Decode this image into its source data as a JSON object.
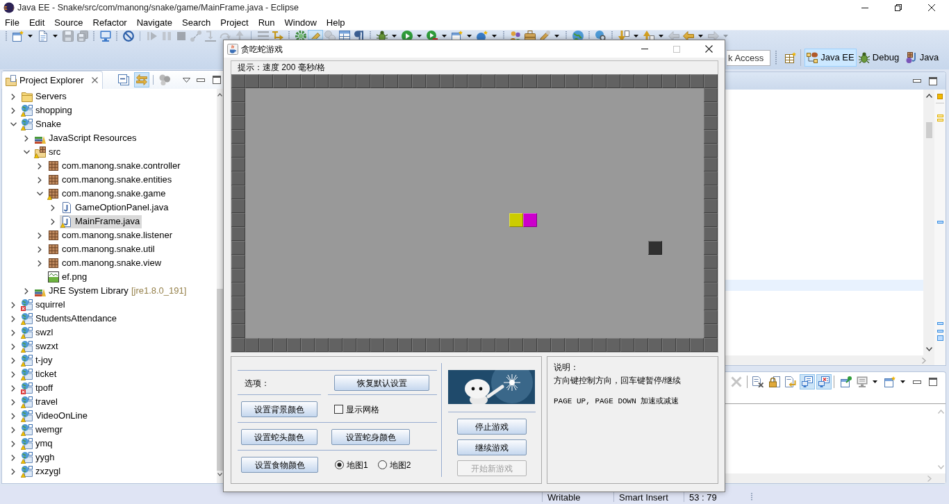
{
  "window": {
    "title": "Java EE - Snake/src/com/manong/snake/game/MainFrame.java - Eclipse"
  },
  "menu": [
    "File",
    "Edit",
    "Source",
    "Refactor",
    "Navigate",
    "Search",
    "Project",
    "Run",
    "Window",
    "Help"
  ],
  "toolbar": [
    {
      "disabled": false,
      "pressed": false
    },
    {
      "disabled": false,
      "pressed": false
    },
    {
      "disabled": true,
      "pressed": false
    },
    {
      "disabled": true,
      "pressed": false
    },
    {
      "disabled": false,
      "pressed": false
    },
    {
      "disabled": false,
      "pressed": false
    },
    {
      "disabled": true,
      "pressed": false
    },
    {
      "disabled": true,
      "pressed": false
    },
    {
      "disabled": true,
      "pressed": false
    },
    {
      "disabled": true,
      "pressed": false
    },
    {
      "disabled": true,
      "pressed": false
    },
    {
      "disabled": true,
      "pressed": false
    },
    {
      "disabled": true,
      "pressed": false
    },
    {
      "disabled": true,
      "pressed": false
    },
    {
      "disabled": false,
      "pressed": false
    },
    {
      "disabled": false,
      "pressed": false
    },
    {
      "disabled": false,
      "pressed": true
    },
    {
      "disabled": true,
      "pressed": false
    },
    {
      "disabled": false,
      "pressed": false
    },
    {
      "disabled": false,
      "pressed": false
    },
    {
      "disabled": false,
      "pressed": false
    },
    {
      "disabled": false,
      "pressed": false
    },
    {
      "disabled": false,
      "pressed": false
    },
    {
      "disabled": false,
      "pressed": false
    },
    {
      "disabled": false,
      "pressed": false
    },
    {
      "disabled": false,
      "pressed": false
    },
    {
      "disabled": false,
      "pressed": false
    },
    {
      "disabled": false,
      "pressed": false
    },
    {
      "disabled": false,
      "pressed": false
    },
    {
      "disabled": false,
      "pressed": false
    },
    {
      "disabled": false,
      "pressed": false
    },
    {
      "disabled": false,
      "pressed": false
    },
    {
      "disabled": true,
      "pressed": false
    },
    {
      "disabled": false,
      "pressed": false
    },
    {
      "disabled": true,
      "pressed": false
    }
  ],
  "quick_access": {
    "placeholder": "k Access"
  },
  "perspectives": [
    {
      "label": "Java EE",
      "selected": true
    },
    {
      "label": "Debug",
      "selected": false
    },
    {
      "label": "Java",
      "selected": false
    }
  ],
  "project_explorer": {
    "title": "Project Explorer",
    "tools": [
      {
        "pressed": false
      },
      {
        "pressed": true
      },
      {
        "pressed": false
      }
    ],
    "items": [
      {
        "label": "Servers",
        "kind": "folder",
        "expanded": false,
        "selected": false
      },
      {
        "label": "shopping",
        "kind": "project",
        "warning": true,
        "expanded": false,
        "selected": false
      },
      {
        "label": "Snake",
        "kind": "project",
        "warning": true,
        "expanded": true,
        "selected": false,
        "children": [
          {
            "label": "JavaScript Resources",
            "kind": "library",
            "expanded": false,
            "selected": false
          },
          {
            "label": "src",
            "kind": "source-folder",
            "warning": true,
            "expanded": true,
            "selected": false,
            "children": [
              {
                "label": "com.manong.snake.controller",
                "kind": "package",
                "expanded": false,
                "selected": false
              },
              {
                "label": "com.manong.snake.entities",
                "kind": "package",
                "expanded": false,
                "selected": false
              },
              {
                "label": "com.manong.snake.game",
                "kind": "package",
                "warning": true,
                "expanded": true,
                "selected": false,
                "children": [
                  {
                    "label": "GameOptionPanel.java",
                    "kind": "java-file",
                    "expanded": false,
                    "selected": false
                  },
                  {
                    "label": "MainFrame.java",
                    "kind": "java-file",
                    "warning": true,
                    "expanded": false,
                    "selected": true
                  }
                ]
              },
              {
                "label": "com.manong.snake.listener",
                "kind": "package",
                "expanded": false,
                "selected": false
              },
              {
                "label": "com.manong.snake.util",
                "kind": "package",
                "expanded": false,
                "selected": false
              },
              {
                "label": "com.manong.snake.view",
                "kind": "package",
                "expanded": false,
                "selected": false
              },
              {
                "label": "ef.png",
                "kind": "image-file",
                "selected": false
              }
            ]
          },
          {
            "label": "JRE System Library",
            "decoration": "[jre1.8.0_191]",
            "kind": "library",
            "expanded": false,
            "selected": false
          }
        ]
      },
      {
        "label": "squirrel",
        "kind": "project",
        "error": true,
        "expanded": false,
        "selected": false
      },
      {
        "label": "StudentsAttendance",
        "kind": "project",
        "warning": true,
        "expanded": false,
        "selected": false
      },
      {
        "label": "swzl",
        "kind": "project",
        "warning": true,
        "expanded": false,
        "selected": false
      },
      {
        "label": "swzxt",
        "kind": "project",
        "warning": true,
        "expanded": false,
        "selected": false
      },
      {
        "label": "t-joy",
        "kind": "project",
        "warning": true,
        "expanded": false,
        "selected": false
      },
      {
        "label": "ticket",
        "kind": "project",
        "warning": true,
        "expanded": false,
        "selected": false
      },
      {
        "label": "tpoff",
        "kind": "project",
        "error": true,
        "expanded": false,
        "selected": false
      },
      {
        "label": "travel",
        "kind": "project",
        "warning": true,
        "expanded": false,
        "selected": false
      },
      {
        "label": "VideoOnLine",
        "kind": "project",
        "warning": true,
        "expanded": false,
        "selected": false
      },
      {
        "label": "wemgr",
        "kind": "project",
        "warning": true,
        "expanded": false,
        "selected": false
      },
      {
        "label": "ymq",
        "kind": "project",
        "warning": true,
        "expanded": false,
        "selected": false
      },
      {
        "label": "yygh",
        "kind": "project",
        "warning": true,
        "expanded": false,
        "selected": false
      },
      {
        "label": "zxzygl",
        "kind": "project",
        "warning": true,
        "expanded": false,
        "selected": false
      }
    ]
  },
  "console": {
    "tools": [
      {
        "disabled": true,
        "pressed": false
      },
      {
        "disabled": false,
        "pressed": false
      },
      {
        "disabled": false,
        "pressed": false
      },
      {
        "disabled": false,
        "pressed": false
      },
      {
        "disabled": false,
        "pressed": true
      },
      {
        "disabled": false,
        "pressed": true
      },
      {
        "disabled": false,
        "pressed": false
      },
      {
        "disabled": false,
        "pressed": false
      },
      {
        "disabled": false,
        "pressed": false
      }
    ]
  },
  "status_bar": [
    "Writable",
    "Smart Insert",
    "53 : 79"
  ],
  "game": {
    "title": "贪吃蛇游戏",
    "maximize": {
      "disabled": true
    },
    "hint": "提示：速度 200 毫秒/格",
    "board": {
      "snake": [
        {
          "color": "#cccc00"
        },
        {
          "color": "#cc00cc"
        }
      ],
      "food": {
        "color": "#303030"
      }
    },
    "options": {
      "label": "选项：",
      "reset": "恢复默认设置",
      "buttons": [
        "设置背景颜色",
        "设置蛇头颜色",
        "设置蛇身颜色",
        "设置食物颜色"
      ],
      "show_grid": {
        "label": "显示网格",
        "checked": false
      },
      "maps": [
        {
          "label": "地图1",
          "selected": true
        },
        {
          "label": "地图2",
          "selected": false
        }
      ]
    },
    "controls": [
      {
        "label": "停止游戏",
        "disabled": false
      },
      {
        "label": "继续游戏",
        "disabled": false
      },
      {
        "label": "开始新游戏",
        "disabled": true
      }
    ],
    "help": {
      "title": "说明：",
      "lines": [
        {
          "kind": "plain",
          "text": "方向键控制方向，回车键暂停/继续"
        },
        {
          "kind": "mono",
          "text": "PAGE UP, PAGE DOWN 加速或减速"
        }
      ]
    }
  }
}
